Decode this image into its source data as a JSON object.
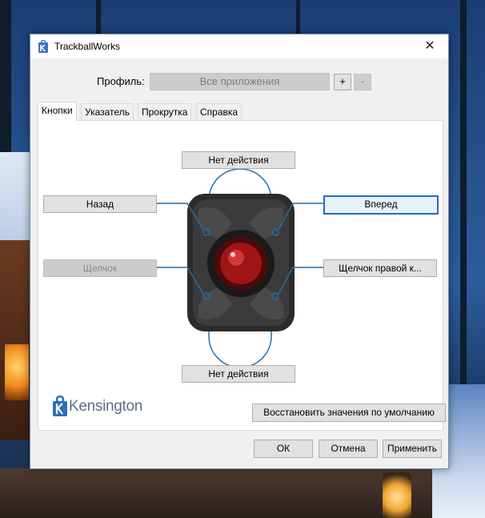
{
  "window": {
    "title": "TrackballWorks",
    "close_glyph": "✕"
  },
  "profile": {
    "label": "Профиль:",
    "selected": "Все приложения",
    "add_label": "+",
    "remove_label": "-"
  },
  "tabs": [
    {
      "label": "Кнопки",
      "active": true
    },
    {
      "label": "Указатель",
      "active": false
    },
    {
      "label": "Прокрутка",
      "active": false
    },
    {
      "label": "Справка",
      "active": false
    }
  ],
  "buttons": {
    "top": "Нет действия",
    "upper_left": "Назад",
    "upper_right": "Вперед",
    "lower_left": "Щелчок",
    "lower_right": "Щелчок правой к...",
    "bottom": "Нет действия"
  },
  "brand": {
    "name": "Kensington"
  },
  "reset_label": "Восстановить значения по умолчанию",
  "footer": {
    "ok": "ОК",
    "cancel": "Отмена",
    "apply": "Применить"
  },
  "colors": {
    "accent": "#2a6bbf",
    "ball": "#c01818",
    "connector": "#1e6fa8"
  }
}
